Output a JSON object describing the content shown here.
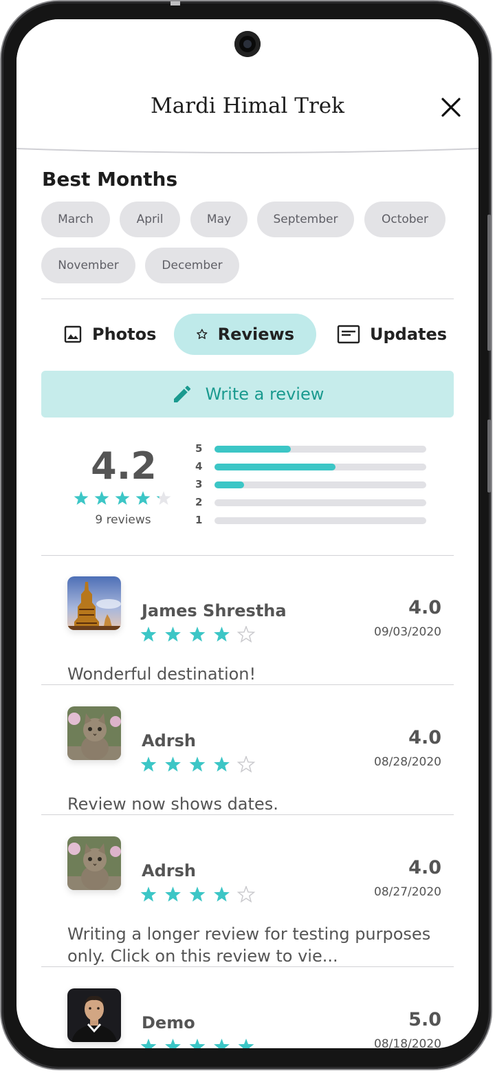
{
  "header": {
    "title": "Mardi Himal Trek"
  },
  "best_months": {
    "title": "Best Months",
    "months": [
      "March",
      "April",
      "May",
      "September",
      "October",
      "November",
      "December"
    ]
  },
  "tabs": [
    {
      "label": "Photos",
      "icon": "image-icon",
      "active": false
    },
    {
      "label": "Reviews",
      "icon": "star-outline-icon",
      "active": true
    },
    {
      "label": "Updates",
      "icon": "article-icon",
      "active": false
    }
  ],
  "write_review": {
    "label": "Write a review",
    "icon": "pencil-icon"
  },
  "rating_summary": {
    "average": "4.2",
    "average_stars": 4.2,
    "count_text": "9 reviews",
    "distribution": [
      {
        "stars": "5",
        "fraction": 0.36
      },
      {
        "stars": "4",
        "fraction": 0.57
      },
      {
        "stars": "3",
        "fraction": 0.14
      },
      {
        "stars": "2",
        "fraction": 0
      },
      {
        "stars": "1",
        "fraction": 0
      }
    ]
  },
  "reviews": [
    {
      "name": "James Shrestha",
      "score": "4.0",
      "stars": 4,
      "date": "09/03/2020",
      "text": "Wonderful destination!",
      "avatar": "temple-photo"
    },
    {
      "name": "Adrsh",
      "score": "4.0",
      "stars": 4,
      "date": "08/28/2020",
      "text": "Review now shows dates.",
      "avatar": "kitten-photo"
    },
    {
      "name": "Adrsh",
      "score": "4.0",
      "stars": 4,
      "date": "08/27/2020",
      "text": "Writing a longer review for testing purposes only. Click on this review to vie...",
      "avatar": "kitten-photo"
    },
    {
      "name": "Demo",
      "score": "5.0",
      "stars": 5,
      "date": "08/18/2020",
      "text": "",
      "avatar": "player-photo"
    }
  ],
  "colors": {
    "accent": "#3cc6c6",
    "accent_bg": "#c6eceb",
    "accent_text": "#1a9a8f",
    "chip_bg": "#e3e3e6"
  }
}
